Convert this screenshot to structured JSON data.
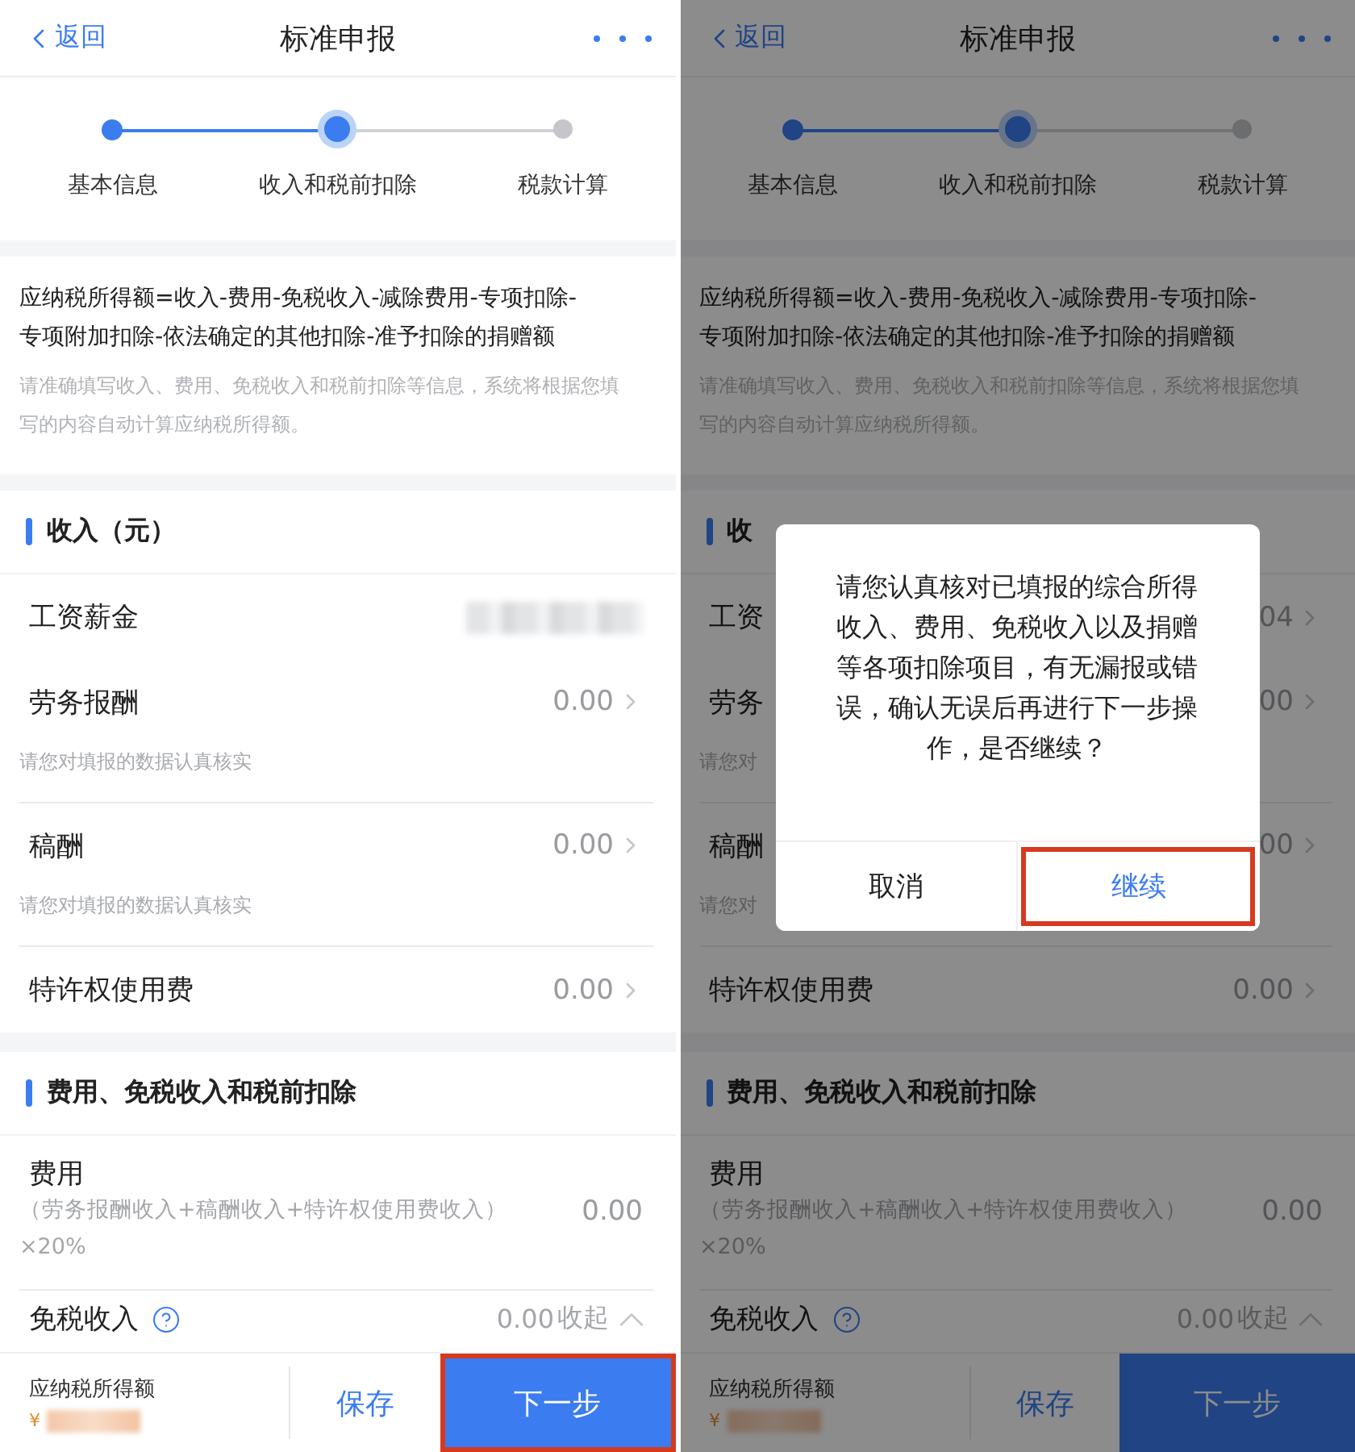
{
  "screens": [
    {
      "header": {
        "back": "返回",
        "title": "标准申报"
      },
      "steps": [
        {
          "label": "基本信息",
          "completed": true,
          "selected": false
        },
        {
          "label": "收入和税前扣除",
          "completed": false,
          "selected": true
        },
        {
          "label": "税款计算",
          "completed": false,
          "selected": false
        }
      ],
      "formula": "应纳税所得额=收入-费用-免税收入-减除费用-专项扣除-\n专项附加扣除-依法确定的其他扣除-准予扣除的捐赠额",
      "note_lines": [
        "请准确填写收入、费用、免税收入和税前扣除等信息，系统将根据您填",
        "写的内容自动计算应纳税所得额。"
      ],
      "income": {
        "title": "收入（元）",
        "items": [
          {
            "label": "工资薪金",
            "redacted": true
          },
          {
            "label": "劳务报酬",
            "value": "0.00",
            "hint": "请您对填报的数据认真核实"
          },
          {
            "label": "稿酬",
            "value": "0.00",
            "hint": "请您对填报的数据认真核实"
          },
          {
            "label": "特许权使用费",
            "value": "0.00"
          }
        ]
      },
      "expense": {
        "title": "费用、免税收入和税前扣除",
        "fee": {
          "label": "费用",
          "formula": "（劳务报酬收入+稿酬收入+特许权使用费收入）\n×20%",
          "value": "0.00"
        },
        "exempt": {
          "label": "免税收入",
          "value": "0.00",
          "toggle": "收起"
        }
      },
      "footer": {
        "label": "应纳税所得额",
        "currency": "¥",
        "amount_redacted": true,
        "save": "保存",
        "next": "下一步",
        "next_highlighted": true
      }
    },
    {
      "header": {
        "back": "返回",
        "title": "标准申报"
      },
      "steps": [
        {
          "label": "基本信息",
          "completed": true,
          "selected": false
        },
        {
          "label": "收入和税前扣除",
          "completed": false,
          "selected": true
        },
        {
          "label": "税款计算",
          "completed": false,
          "selected": false
        }
      ],
      "formula": "应纳税所得额=收入-费用-免税收入-减除费用-专项扣除-\n专项附加扣除-依法确定的其他扣除-准予扣除的捐赠额",
      "note_lines": [
        "请准确填写收入、费用、免税收入和税前扣除等信息，系统将根据您填",
        "写的内容自动计算应纳税所得额。"
      ],
      "income": {
        "title": "收",
        "items": [
          {
            "label": "工资",
            "value": "04"
          },
          {
            "label": "劳务",
            "value": "00",
            "hint": "请您对"
          },
          {
            "label": "稿酬",
            "value": "00",
            "hint": "请您对"
          },
          {
            "label": "特许权使用费",
            "value": "0.00"
          }
        ]
      },
      "expense": {
        "title": "费用、免税收入和税前扣除",
        "fee": {
          "label": "费用",
          "formula": "（劳务报酬收入+稿酬收入+特许权使用费收入）\n×20%",
          "value": "0.00"
        },
        "exempt": {
          "label": "免税收入",
          "value": "0.00",
          "toggle": "收起"
        }
      },
      "footer": {
        "label": "应纳税所得额",
        "currency": "¥",
        "amount_redacted": true,
        "save": "保存",
        "next": "下一步",
        "next_highlighted": false
      },
      "dialog": {
        "message_lines": [
          "请您认真核对已填报的综合所得",
          "收入、费用、免税收入以及捐赠",
          "等各项扣除项目，有无漏报或错",
          "误，确认无误后再进行下一步操",
          "作，是否继续？"
        ],
        "buttons": [
          {
            "label": "取消",
            "primary": false,
            "highlighted": false
          },
          {
            "label": "继续",
            "primary": true,
            "highlighted": true
          }
        ]
      }
    }
  ]
}
